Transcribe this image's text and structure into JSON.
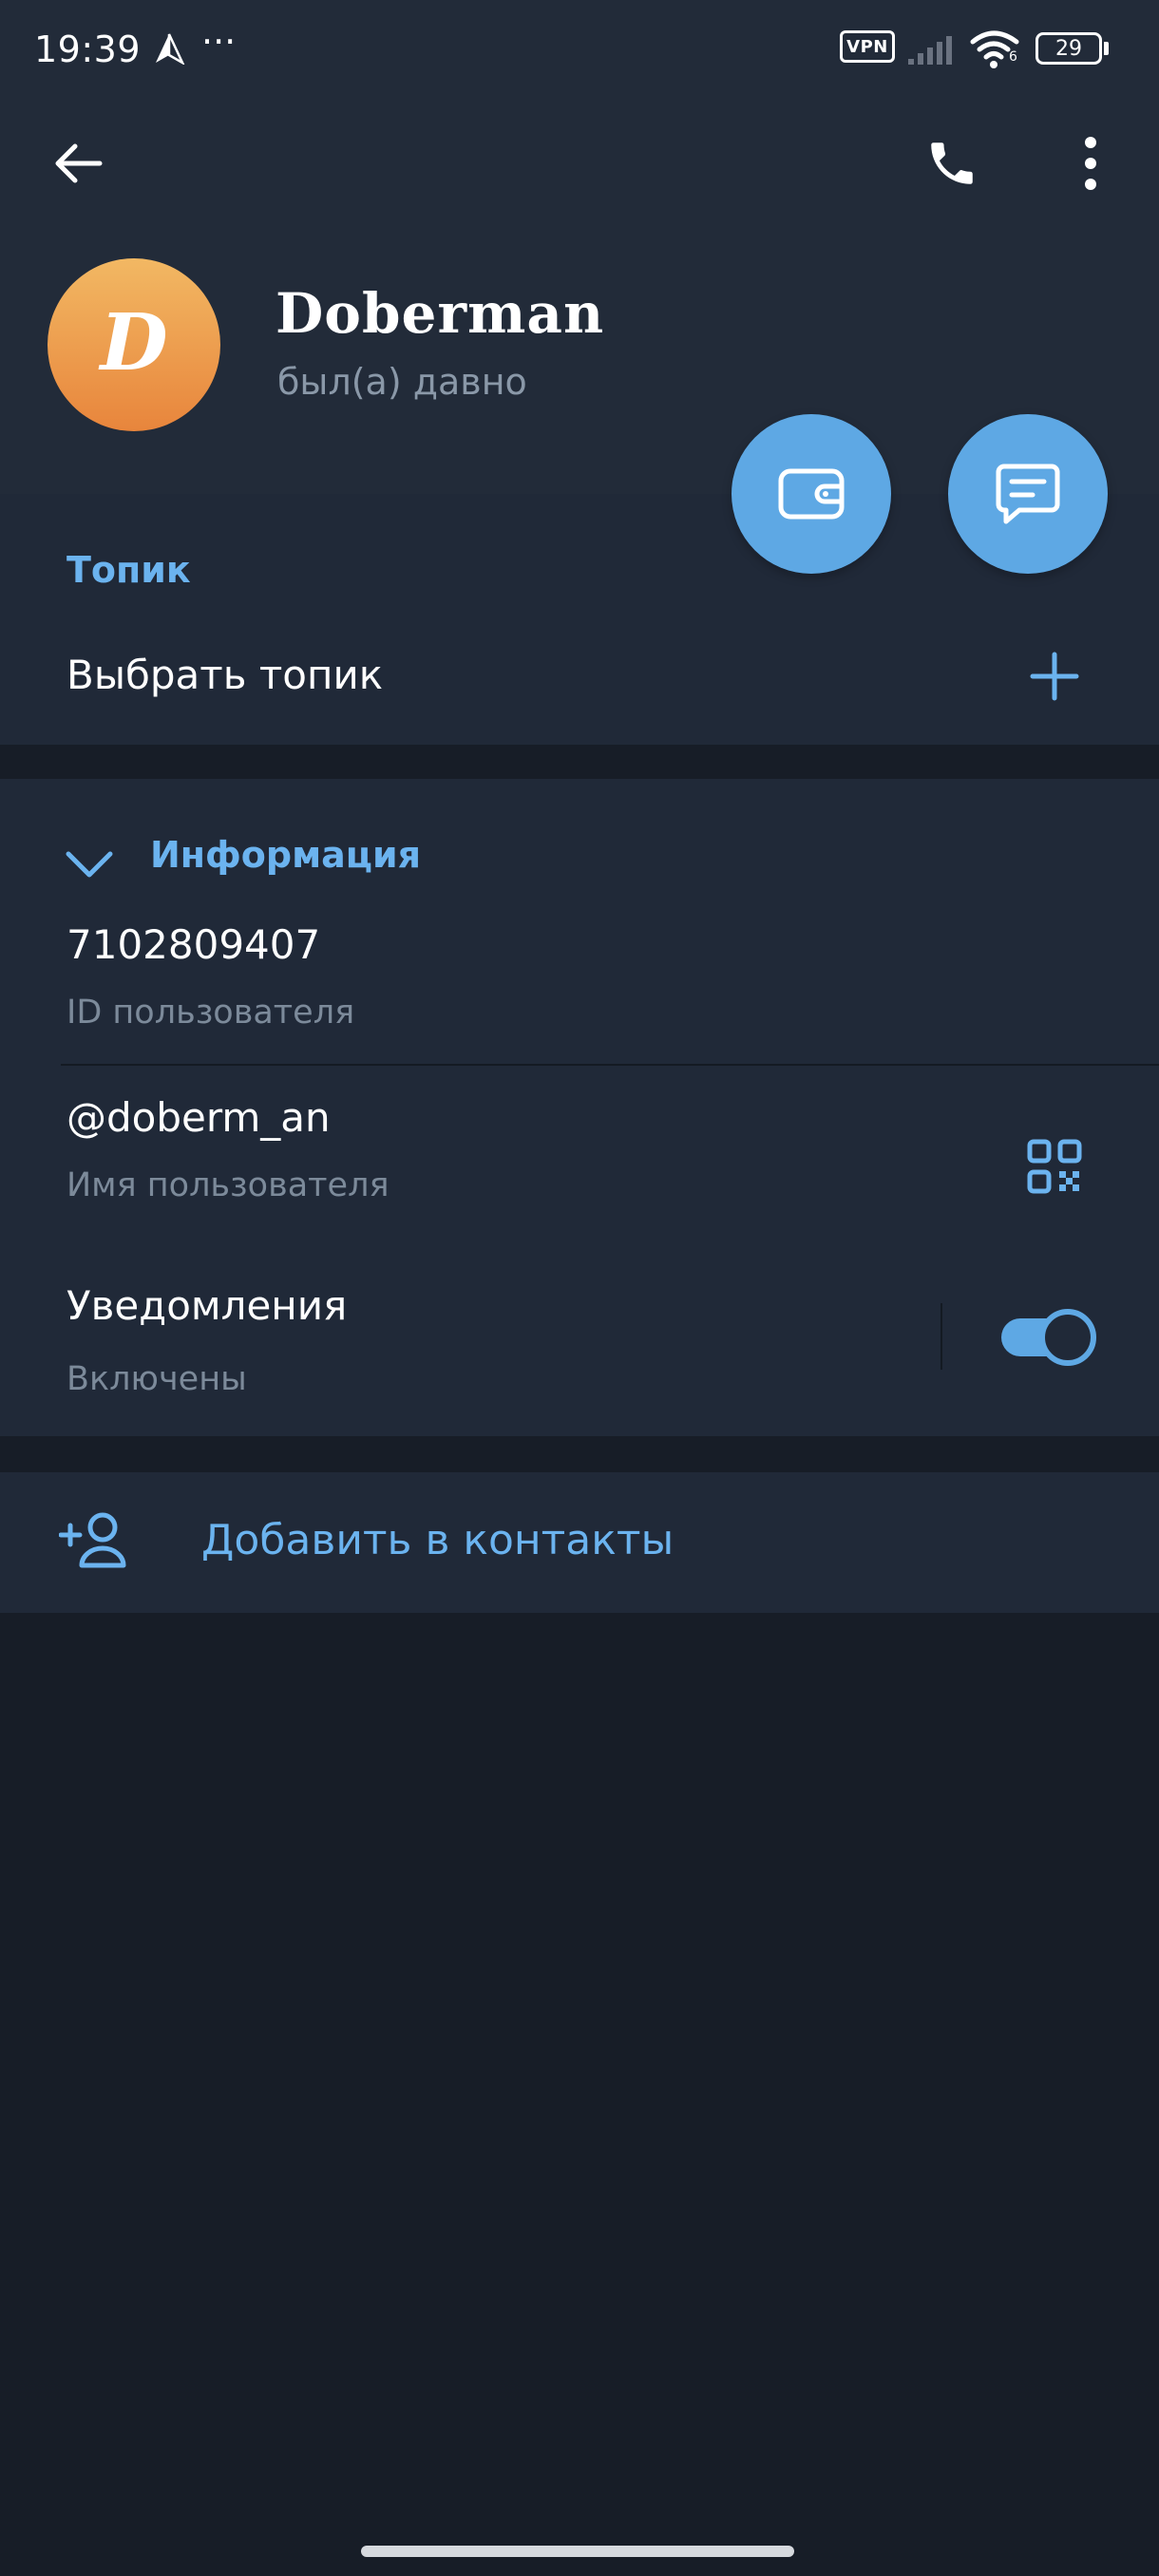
{
  "status_bar": {
    "time": "19:39",
    "more": "···",
    "vpn": "VPN",
    "battery": "29",
    "wifi_sub": "6"
  },
  "toolbar": {
    "back_icon": "arrow-left-icon",
    "call_icon": "phone-icon",
    "more_icon": "more-vertical-icon"
  },
  "profile": {
    "avatar_letter": "D",
    "name": "Doberman",
    "status": "был(а) давно",
    "avatar_gradient": [
      "#f2b863",
      "#e8853c"
    ]
  },
  "fabs": {
    "wallet_icon": "wallet-icon",
    "message_icon": "message-icon",
    "color": "#5ea8e4"
  },
  "topic": {
    "title": "Топик",
    "choose_label": "Выбрать топик"
  },
  "info": {
    "title": "Информация",
    "user_id": "7102809407",
    "user_id_label": "ID пользователя",
    "username": "@doberm_an",
    "username_label": "Имя пользователя",
    "notifications": "Уведомления",
    "notifications_state": "Включены",
    "notifications_on": true
  },
  "actions": {
    "add_contact": "Добавить в контакты"
  },
  "colors": {
    "accent": "#6bb3ef",
    "header_bg": "#222b39",
    "section_bg": "#202938",
    "page_bg": "#171d27"
  }
}
